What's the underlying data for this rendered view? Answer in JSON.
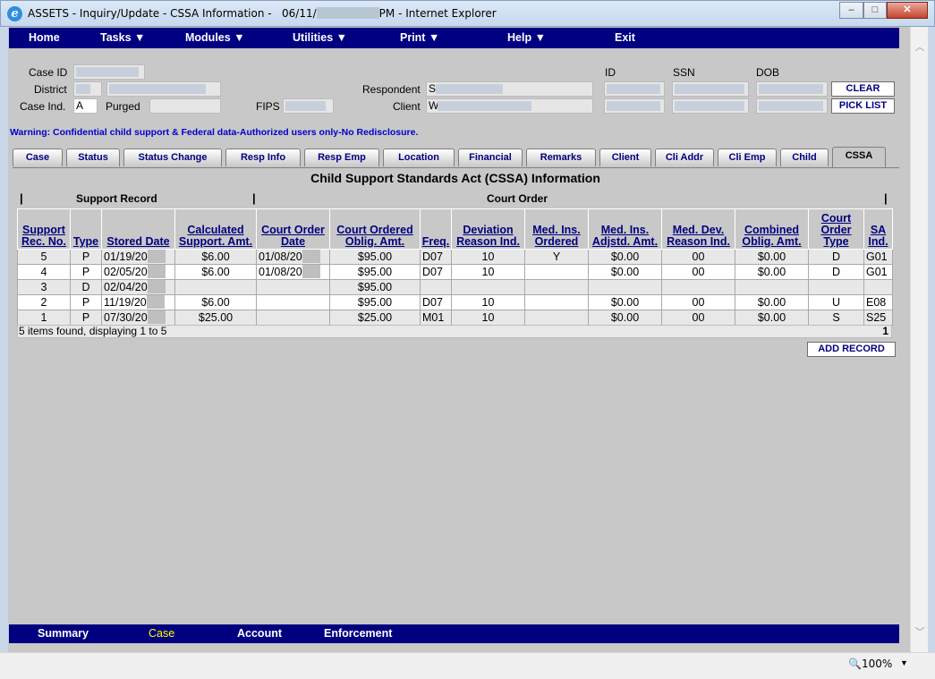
{
  "window": {
    "title_prefix": "ASSETS - Inquiry/Update - CSSA Information -   06/11/",
    "title_suffix": "PM - Internet Explorer",
    "zoom": "100%"
  },
  "topnav": {
    "home": "Home",
    "tasks": "Tasks",
    "modules": "Modules",
    "utilities": "Utilities",
    "print": "Print",
    "help": "Help",
    "exit": "Exit"
  },
  "header": {
    "case_id_label": "Case ID",
    "district_label": "District",
    "case_ind_label": "Case Ind.",
    "case_ind_value": "A",
    "purged_label": "Purged",
    "fips_label": "FIPS",
    "respondent_label": "Respondent",
    "respondent_value": "S",
    "client_label": "Client",
    "client_value": "W",
    "id_label": "ID",
    "ssn_label": "SSN",
    "dob_label": "DOB",
    "clear_button": "CLEAR",
    "pick_list_button": "PICK LIST"
  },
  "warning": "Warning: Confidential child support & Federal data-Authorized users only-No Redisclosure.",
  "tabs": [
    "Case",
    "Status",
    "Status Change",
    "Resp Info",
    "Resp Emp",
    "Location",
    "Financial",
    "Remarks",
    "Client",
    "Cli Addr",
    "Cli Emp",
    "Child",
    "CSSA"
  ],
  "section_title": "Child Support Standards Act (CSSA) Information",
  "groups": {
    "support_record": "Support Record",
    "court_order": "Court Order"
  },
  "table": {
    "columns": [
      "Support Rec. No.",
      "Type",
      "Stored Date",
      "Calculated Support. Amt.",
      "Court Order Date",
      "Court Ordered Oblig. Amt.",
      "Freq.",
      "Deviation Reason Ind.",
      "Med. Ins. Ordered",
      "Med. Ins. Adjstd. Amt.",
      "Med. Dev. Reason Ind.",
      "Combined Oblig. Amt.",
      "Court Order Type",
      "SA Ind."
    ],
    "rows": [
      [
        "5",
        "P",
        "01/19/20",
        "$6.00",
        "01/08/20",
        "$95.00",
        "D07",
        "10",
        "Y",
        "$0.00",
        "00",
        "$0.00",
        "D",
        "G01"
      ],
      [
        "4",
        "P",
        "02/05/20",
        "$6.00",
        "01/08/20",
        "$95.00",
        "D07",
        "10",
        "",
        "$0.00",
        "00",
        "$0.00",
        "D",
        "G01"
      ],
      [
        "3",
        "D",
        "02/04/20",
        "",
        "",
        "$95.00",
        "",
        "",
        "",
        "",
        "",
        "",
        "",
        ""
      ],
      [
        "2",
        "P",
        "11/19/20",
        "$6.00",
        "",
        "$95.00",
        "D07",
        "10",
        "",
        "$0.00",
        "00",
        "$0.00",
        "U",
        "E08"
      ],
      [
        "1",
        "P",
        "07/30/20",
        "$25.00",
        "",
        "$25.00",
        "M01",
        "10",
        "",
        "$0.00",
        "00",
        "$0.00",
        "S",
        "S25"
      ]
    ],
    "footer_text": "5 items found, displaying 1 to 5",
    "page": "1"
  },
  "add_record_button": "ADD RECORD",
  "bottomnav": {
    "summary": "Summary",
    "case": "Case",
    "account": "Account",
    "enforcement": "Enforcement"
  }
}
